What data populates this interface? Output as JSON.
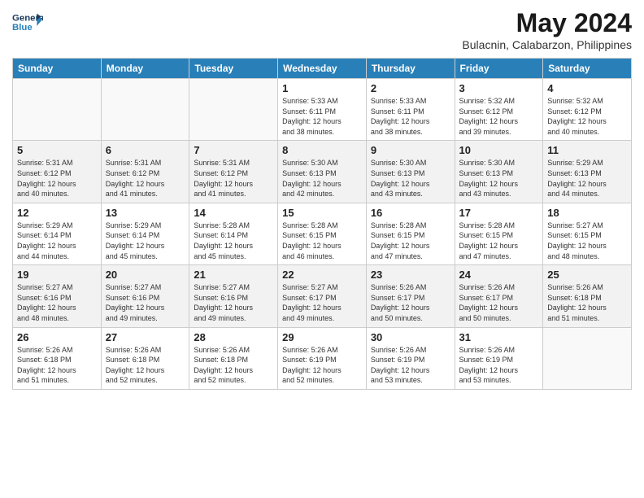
{
  "header": {
    "logo_general": "General",
    "logo_blue": "Blue",
    "title": "May 2024",
    "subtitle": "Bulacnin, Calabarzon, Philippines"
  },
  "days_of_week": [
    "Sunday",
    "Monday",
    "Tuesday",
    "Wednesday",
    "Thursday",
    "Friday",
    "Saturday"
  ],
  "weeks": [
    [
      {
        "day": "",
        "info": ""
      },
      {
        "day": "",
        "info": ""
      },
      {
        "day": "",
        "info": ""
      },
      {
        "day": "1",
        "info": "Sunrise: 5:33 AM\nSunset: 6:11 PM\nDaylight: 12 hours\nand 38 minutes."
      },
      {
        "day": "2",
        "info": "Sunrise: 5:33 AM\nSunset: 6:11 PM\nDaylight: 12 hours\nand 38 minutes."
      },
      {
        "day": "3",
        "info": "Sunrise: 5:32 AM\nSunset: 6:12 PM\nDaylight: 12 hours\nand 39 minutes."
      },
      {
        "day": "4",
        "info": "Sunrise: 5:32 AM\nSunset: 6:12 PM\nDaylight: 12 hours\nand 40 minutes."
      }
    ],
    [
      {
        "day": "5",
        "info": "Sunrise: 5:31 AM\nSunset: 6:12 PM\nDaylight: 12 hours\nand 40 minutes."
      },
      {
        "day": "6",
        "info": "Sunrise: 5:31 AM\nSunset: 6:12 PM\nDaylight: 12 hours\nand 41 minutes."
      },
      {
        "day": "7",
        "info": "Sunrise: 5:31 AM\nSunset: 6:12 PM\nDaylight: 12 hours\nand 41 minutes."
      },
      {
        "day": "8",
        "info": "Sunrise: 5:30 AM\nSunset: 6:13 PM\nDaylight: 12 hours\nand 42 minutes."
      },
      {
        "day": "9",
        "info": "Sunrise: 5:30 AM\nSunset: 6:13 PM\nDaylight: 12 hours\nand 43 minutes."
      },
      {
        "day": "10",
        "info": "Sunrise: 5:30 AM\nSunset: 6:13 PM\nDaylight: 12 hours\nand 43 minutes."
      },
      {
        "day": "11",
        "info": "Sunrise: 5:29 AM\nSunset: 6:13 PM\nDaylight: 12 hours\nand 44 minutes."
      }
    ],
    [
      {
        "day": "12",
        "info": "Sunrise: 5:29 AM\nSunset: 6:14 PM\nDaylight: 12 hours\nand 44 minutes."
      },
      {
        "day": "13",
        "info": "Sunrise: 5:29 AM\nSunset: 6:14 PM\nDaylight: 12 hours\nand 45 minutes."
      },
      {
        "day": "14",
        "info": "Sunrise: 5:28 AM\nSunset: 6:14 PM\nDaylight: 12 hours\nand 45 minutes."
      },
      {
        "day": "15",
        "info": "Sunrise: 5:28 AM\nSunset: 6:15 PM\nDaylight: 12 hours\nand 46 minutes."
      },
      {
        "day": "16",
        "info": "Sunrise: 5:28 AM\nSunset: 6:15 PM\nDaylight: 12 hours\nand 47 minutes."
      },
      {
        "day": "17",
        "info": "Sunrise: 5:28 AM\nSunset: 6:15 PM\nDaylight: 12 hours\nand 47 minutes."
      },
      {
        "day": "18",
        "info": "Sunrise: 5:27 AM\nSunset: 6:15 PM\nDaylight: 12 hours\nand 48 minutes."
      }
    ],
    [
      {
        "day": "19",
        "info": "Sunrise: 5:27 AM\nSunset: 6:16 PM\nDaylight: 12 hours\nand 48 minutes."
      },
      {
        "day": "20",
        "info": "Sunrise: 5:27 AM\nSunset: 6:16 PM\nDaylight: 12 hours\nand 49 minutes."
      },
      {
        "day": "21",
        "info": "Sunrise: 5:27 AM\nSunset: 6:16 PM\nDaylight: 12 hours\nand 49 minutes."
      },
      {
        "day": "22",
        "info": "Sunrise: 5:27 AM\nSunset: 6:17 PM\nDaylight: 12 hours\nand 49 minutes."
      },
      {
        "day": "23",
        "info": "Sunrise: 5:26 AM\nSunset: 6:17 PM\nDaylight: 12 hours\nand 50 minutes."
      },
      {
        "day": "24",
        "info": "Sunrise: 5:26 AM\nSunset: 6:17 PM\nDaylight: 12 hours\nand 50 minutes."
      },
      {
        "day": "25",
        "info": "Sunrise: 5:26 AM\nSunset: 6:18 PM\nDaylight: 12 hours\nand 51 minutes."
      }
    ],
    [
      {
        "day": "26",
        "info": "Sunrise: 5:26 AM\nSunset: 6:18 PM\nDaylight: 12 hours\nand 51 minutes."
      },
      {
        "day": "27",
        "info": "Sunrise: 5:26 AM\nSunset: 6:18 PM\nDaylight: 12 hours\nand 52 minutes."
      },
      {
        "day": "28",
        "info": "Sunrise: 5:26 AM\nSunset: 6:18 PM\nDaylight: 12 hours\nand 52 minutes."
      },
      {
        "day": "29",
        "info": "Sunrise: 5:26 AM\nSunset: 6:19 PM\nDaylight: 12 hours\nand 52 minutes."
      },
      {
        "day": "30",
        "info": "Sunrise: 5:26 AM\nSunset: 6:19 PM\nDaylight: 12 hours\nand 53 minutes."
      },
      {
        "day": "31",
        "info": "Sunrise: 5:26 AM\nSunset: 6:19 PM\nDaylight: 12 hours\nand 53 minutes."
      },
      {
        "day": "",
        "info": ""
      }
    ]
  ]
}
